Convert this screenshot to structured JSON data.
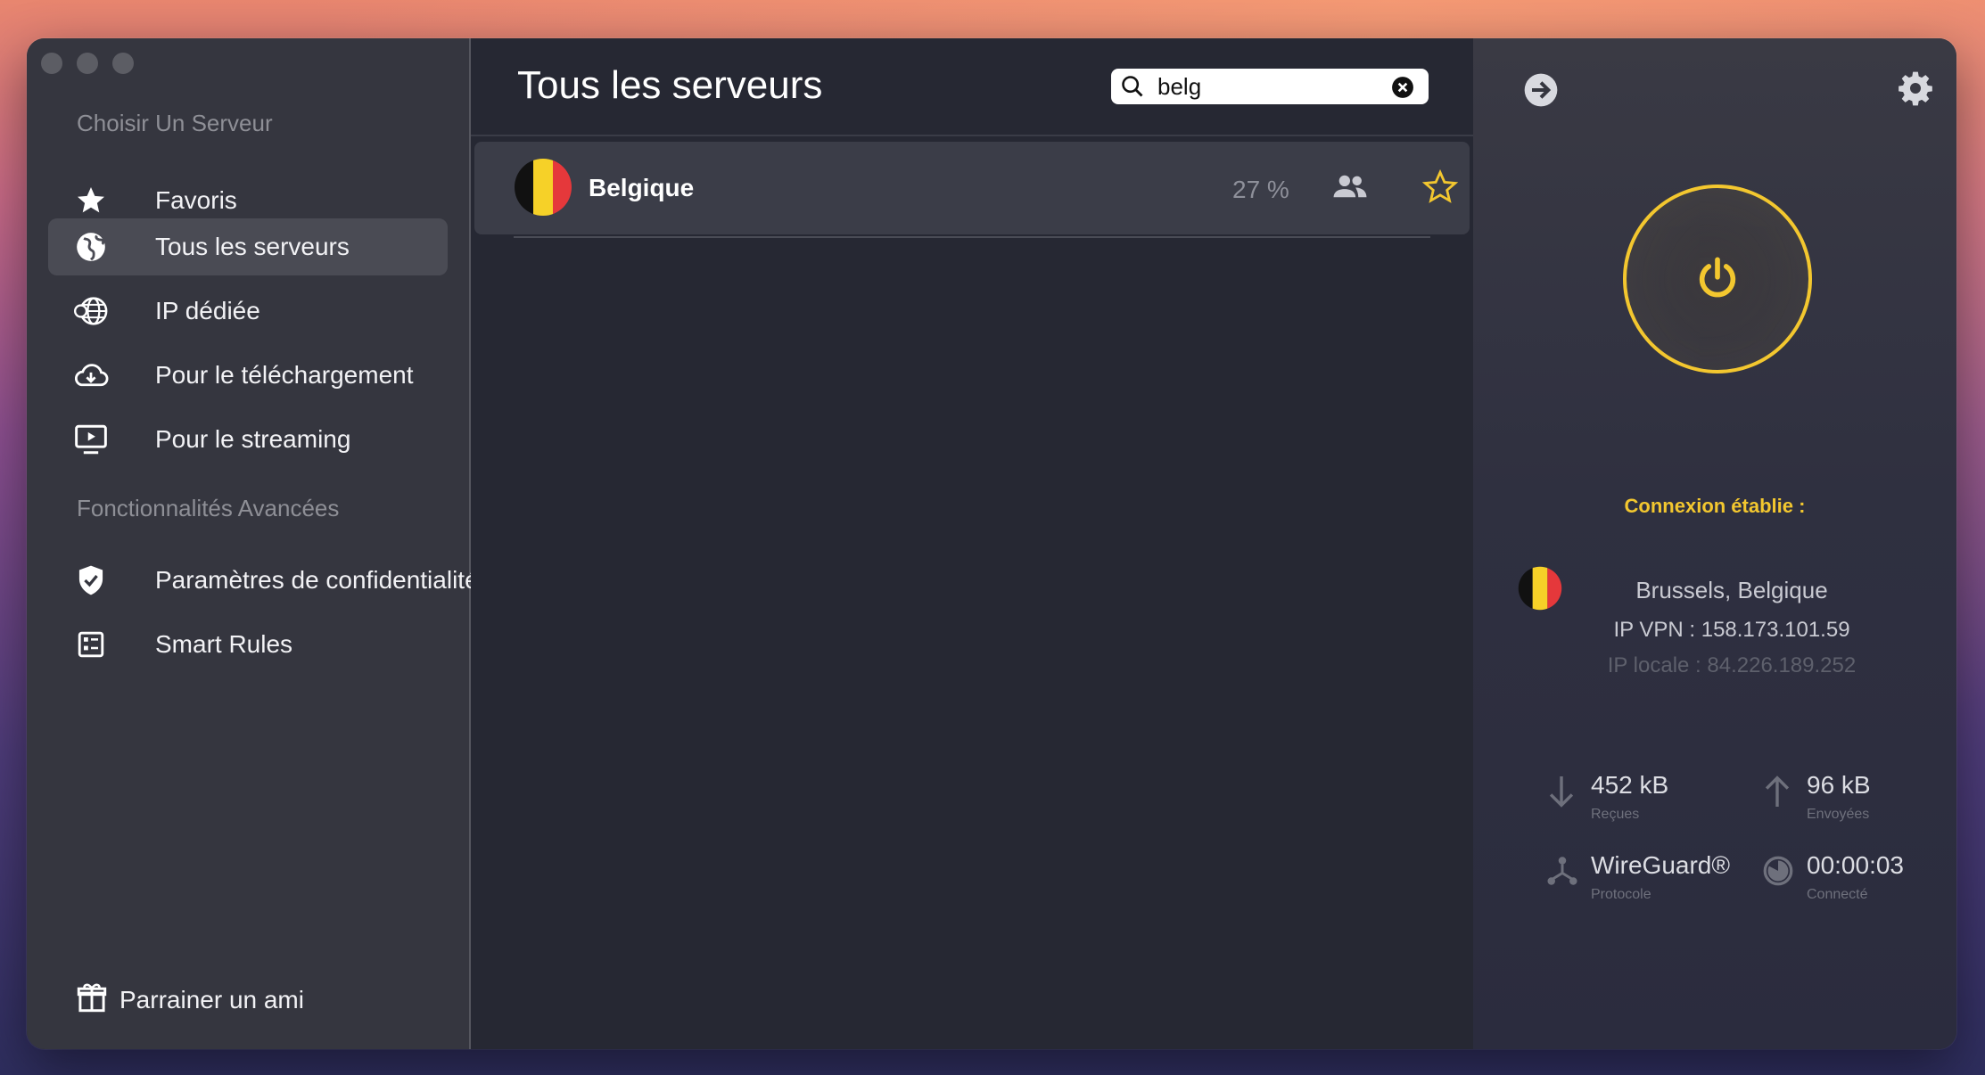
{
  "sidebar": {
    "section_servers": "Choisir Un Serveur",
    "items": [
      {
        "label": "Favoris"
      },
      {
        "label": "Tous les serveurs"
      },
      {
        "label": "IP dédiée"
      },
      {
        "label": "Pour le téléchargement"
      },
      {
        "label": "Pour le streaming"
      }
    ],
    "section_advanced": "Fonctionnalités Avancées",
    "advanced_items": [
      {
        "label": "Paramètres de confidentialité"
      },
      {
        "label": "Smart Rules"
      }
    ],
    "refer_label": "Parrainer un ami"
  },
  "main": {
    "title": "Tous les serveurs",
    "search": {
      "value": "belg"
    },
    "servers": [
      {
        "name": "Belgique",
        "load": "27 %"
      }
    ]
  },
  "panel": {
    "status": "Connexion établie :",
    "location": "Brussels, Belgique",
    "vpn_ip": "IP VPN : 158.173.101.59",
    "local_ip": "IP locale : 84.226.189.252",
    "stats": {
      "received": {
        "value": "452 kB",
        "label": "Reçues"
      },
      "sent": {
        "value": "96 kB",
        "label": "Envoyées"
      },
      "protocol": {
        "value": "WireGuard®",
        "label": "Protocole"
      },
      "connected": {
        "value": "00:00:03",
        "label": "Connecté"
      }
    }
  },
  "colors": {
    "accent": "#f3c72f",
    "sidebar_bg": "#35363f",
    "main_bg": "#262833",
    "row_bg": "#3b3d48",
    "flag_black": "#111111",
    "flag_yellow": "#f6d128",
    "flag_red": "#e5383b"
  },
  "icons": {
    "favorites": "star-icon",
    "all_servers": "globe-icon",
    "dedicated_ip": "dedicated-ip-globe-icon",
    "download": "cloud-download-icon",
    "streaming": "play-screen-icon",
    "privacy": "shield-check-icon",
    "smart_rules": "checklist-icon",
    "refer": "gift-icon",
    "search": "search-icon",
    "clear": "clear-icon",
    "users": "users-icon",
    "favorite_toggle": "star-outline-icon",
    "disconnect": "arrow-right-circle-icon",
    "settings": "gear-icon",
    "power": "power-icon",
    "download_stat": "arrow-down-icon",
    "upload_stat": "arrow-up-icon",
    "protocol": "protocol-nodes-icon",
    "timer": "timer-icon"
  }
}
